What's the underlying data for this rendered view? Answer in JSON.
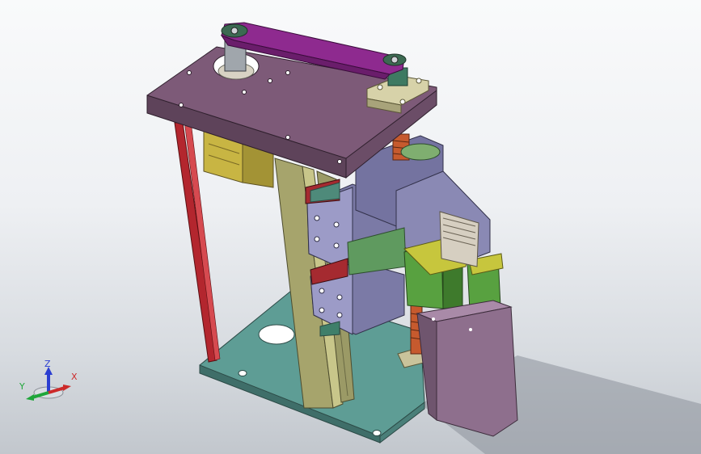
{
  "viewport": {
    "background_top": "#f9fafb",
    "background_bottom": "#c2c7cd"
  },
  "model": {
    "parts": [
      {
        "name": "base-plate",
        "color": "#5f9e97"
      },
      {
        "name": "top-plate",
        "color": "#7d5a78"
      },
      {
        "name": "timing-belt",
        "color": "#8e2a8f"
      },
      {
        "name": "support-column",
        "color": "#9b9a66"
      },
      {
        "name": "guide-rod",
        "color": "#b3262e"
      },
      {
        "name": "stepper-motor",
        "color": "#c8b543"
      },
      {
        "name": "carriage-block",
        "color": "#7b7aa6"
      },
      {
        "name": "gripper-finger",
        "color": "#58a140"
      },
      {
        "name": "housing-box",
        "color": "#8e6f8d"
      }
    ]
  },
  "triad": {
    "z_label": "Z",
    "y_label": "Y",
    "x_label": "X",
    "z_color": "#2b3ed1",
    "y_color": "#1fa63a",
    "x_color": "#cc2a2a"
  }
}
